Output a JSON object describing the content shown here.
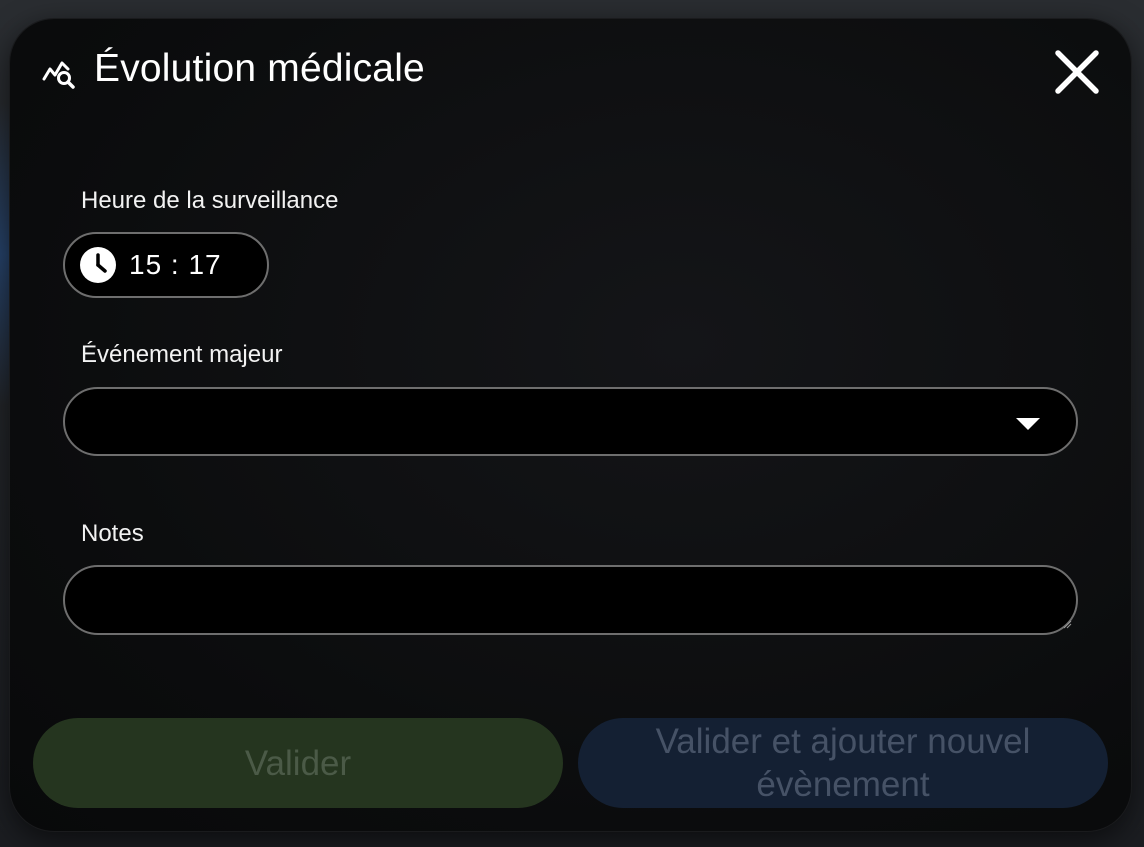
{
  "dialog": {
    "title": "Évolution médicale",
    "icon": "chart-search-icon",
    "close_icon": "close-icon"
  },
  "fields": {
    "time": {
      "label": "Heure de la surveillance",
      "value": "15 : 17",
      "icon": "clock-icon"
    },
    "major_event": {
      "label": "Événement majeur",
      "value": "",
      "icon": "caret-down-icon"
    },
    "notes": {
      "label": "Notes",
      "value": ""
    }
  },
  "actions": {
    "validate_label": "Valider",
    "validate_add_label": "Valider et ajouter nouvel évènement"
  },
  "colors": {
    "validate_bg": "#25351f",
    "validate_add_bg": "#142033",
    "field_border": "#6e6e6e",
    "text": "#ffffff"
  }
}
